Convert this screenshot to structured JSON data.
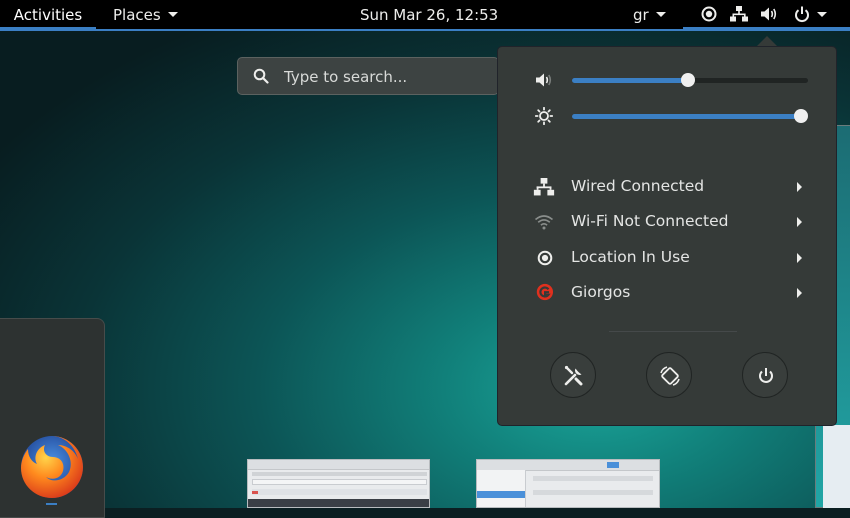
{
  "topbar": {
    "activities_label": "Activities",
    "places_label": "Places",
    "clock": "Sun Mar 26, 12:53",
    "keyboard_layout": "gr",
    "status_icons": [
      "location-icon",
      "network-wired-icon",
      "volume-icon",
      "power-icon",
      "chevron-down-icon"
    ]
  },
  "search": {
    "placeholder": "Type to search..."
  },
  "system_menu": {
    "volume": {
      "icon": "volume-low-icon",
      "level": 0.49
    },
    "brightness": {
      "icon": "brightness-icon",
      "level": 1.0
    },
    "items": [
      {
        "icon": "network-wired-icon",
        "label": "Wired Connected"
      },
      {
        "icon": "wifi-icon",
        "label": "Wi-Fi Not Connected"
      },
      {
        "icon": "location-icon",
        "label": "Location In Use"
      },
      {
        "icon": "user-icon",
        "label": "Giorgos"
      }
    ],
    "buttons": [
      "settings-icon",
      "rotation-lock-icon",
      "power-icon"
    ]
  },
  "dash": {
    "apps": [
      "firefox-icon"
    ]
  },
  "colors": {
    "accent": "#3b7fc4",
    "panel": "#353a38",
    "topbar": "#000000",
    "user_icon": "#e0301e"
  }
}
